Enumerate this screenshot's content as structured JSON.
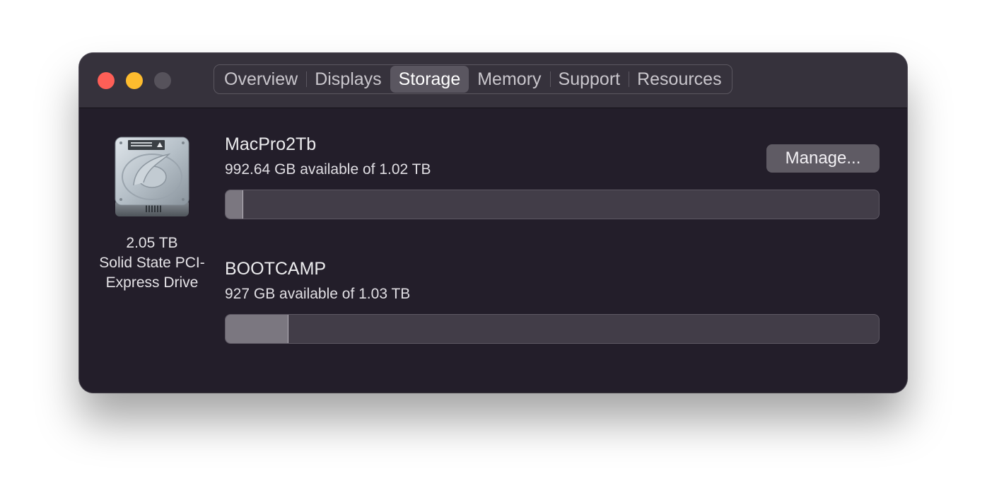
{
  "tabs": [
    {
      "label": "Overview"
    },
    {
      "label": "Displays"
    },
    {
      "label": "Storage"
    },
    {
      "label": "Memory"
    },
    {
      "label": "Support"
    },
    {
      "label": "Resources"
    }
  ],
  "active_tab": "Storage",
  "drive": {
    "icon": "hard-drive-icon",
    "capacity": "2.05 TB",
    "type_line1": "Solid State PCI-",
    "type_line2": "Express Drive"
  },
  "volumes": [
    {
      "name": "MacPro2Tb",
      "available": "992.64 GB available of 1.02 TB",
      "used_fraction": 0.027
    },
    {
      "name": "BOOTCAMP",
      "available": "927 GB available of 1.03 TB",
      "used_fraction": 0.096
    }
  ],
  "manage_button": {
    "label": "Manage..."
  },
  "colors": {
    "close": "#fe5f57",
    "minimize": "#febc2e",
    "zoom_disabled": "#56525b"
  }
}
